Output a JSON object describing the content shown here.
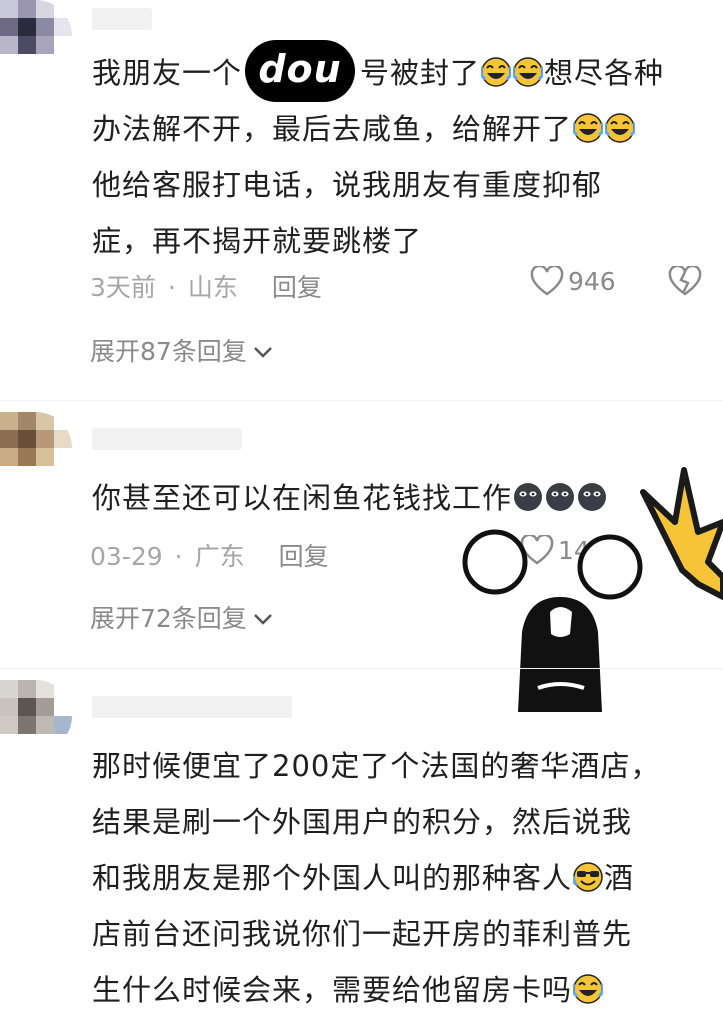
{
  "comments": [
    {
      "lines": [
        "我朋友一个",
        "号被封了",
        "想尽各种",
        "办法解不开，最后去咸鱼，给解开了",
        "他给客服打电话，说我朋友有重度抑郁",
        "症，再不揭开就要跳楼了"
      ],
      "badge": "dou",
      "time": "3天前",
      "location": "山东",
      "reply": "回复",
      "likes": "946",
      "expand": "展开87条回复"
    },
    {
      "text": "你甚至还可以在闲鱼花钱找工作",
      "time": "03-29",
      "location": "广东",
      "reply": "回复",
      "likes": "14",
      "expand": "展开72条回复"
    },
    {
      "lines": [
        "那时候便宜了200定了个法国的奢华酒店，",
        "结果是刷一个外国用户的积分，然后说我",
        "和我朋友是那个外国人叫的那种客人",
        "酒",
        "店前台还问我说你们一起开房的菲利普先",
        "生什么时候会来，需要给他留房卡吗"
      ]
    }
  ],
  "icons": {
    "heart": "heart-outline-icon",
    "dislike": "broken-heart-icon",
    "chevron": "chevron-down-icon",
    "emoji_laugh": "laughing-tears-emoji",
    "emoji_dark": "dark-face-emoji",
    "emoji_sunglasses": "sunglasses-emoji",
    "sticker": "shocked-face-sticker"
  },
  "colors": {
    "text": "#1f1f1f",
    "meta": "#a6a6a6",
    "emoji_yellow": "#f6c438"
  }
}
